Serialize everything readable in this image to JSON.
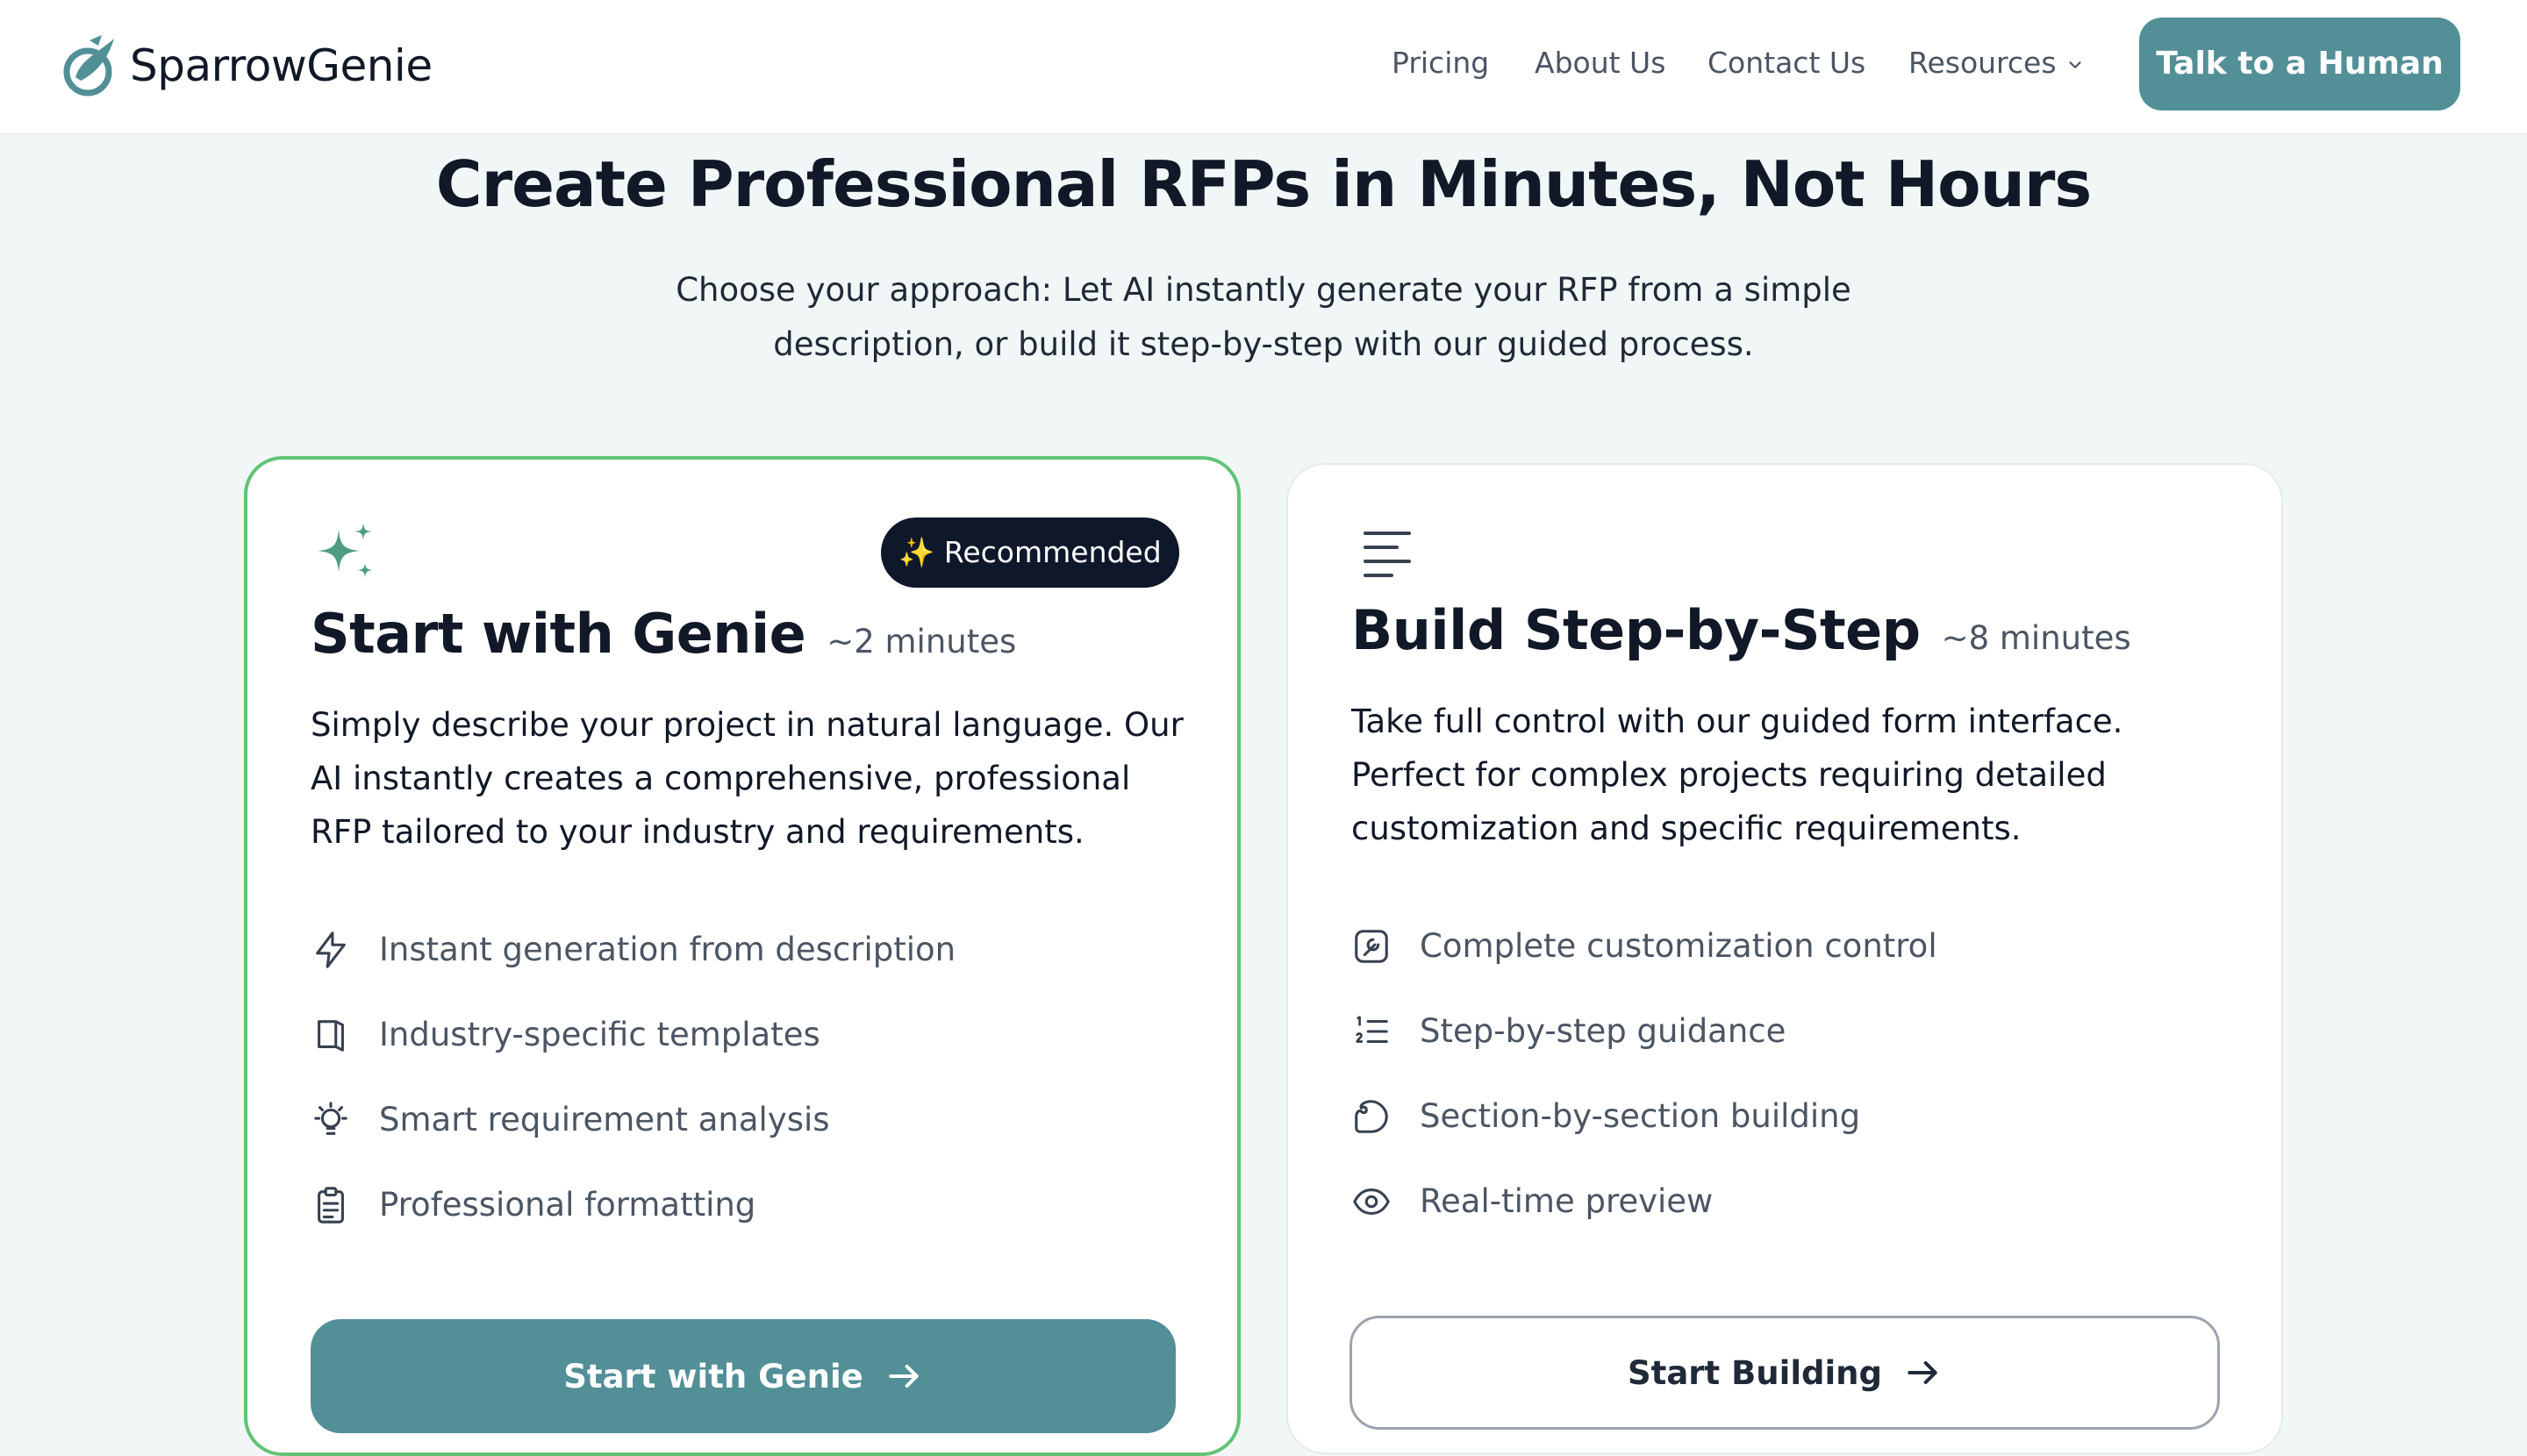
{
  "header": {
    "brand": "SparrowGenie",
    "nav": [
      {
        "label": "Pricing"
      },
      {
        "label": "About Us"
      },
      {
        "label": "Contact Us"
      },
      {
        "label": "Resources"
      }
    ],
    "cta_label": "Talk to a Human"
  },
  "hero": {
    "title": "Create Professional RFPs in Minutes, Not Hours",
    "subtitle_line1": "Choose your approach: Let AI instantly generate your RFP from a simple",
    "subtitle_line2": "description, or build it step-by-step with our guided process."
  },
  "cards": [
    {
      "badge": "✨ Recommended",
      "title": "Start with Genie",
      "time": "~2 minutes",
      "description": "Simply describe your project in natural language. Our AI instantly creates a comprehensive, professional RFP tailored to your industry and requirements.",
      "features": [
        {
          "icon": "lightning-icon",
          "label": "Instant generation from description"
        },
        {
          "icon": "book-icon",
          "label": "Industry-specific templates"
        },
        {
          "icon": "lightbulb-icon",
          "label": "Smart requirement analysis"
        },
        {
          "icon": "clipboard-icon",
          "label": "Professional formatting"
        }
      ],
      "button_label": "Start with Genie"
    },
    {
      "title": "Build Step-by-Step",
      "time": "~8 minutes",
      "description": "Take full control with our guided form interface. Perfect for complex projects requiring detailed customization and specific requirements.",
      "features": [
        {
          "icon": "customize-icon",
          "label": "Complete customization control"
        },
        {
          "icon": "numbered-list-icon",
          "label": "Step-by-step guidance"
        },
        {
          "icon": "puzzle-icon",
          "label": "Section-by-section building"
        },
        {
          "icon": "eye-icon",
          "label": "Real-time preview"
        }
      ],
      "button_label": "Start Building"
    }
  ],
  "colors": {
    "accent": "#528f97",
    "background": "#f1f7f6",
    "recommended_border": "#63c276",
    "badge_bg": "#0f172a",
    "sparkle": "#4e9c84"
  }
}
